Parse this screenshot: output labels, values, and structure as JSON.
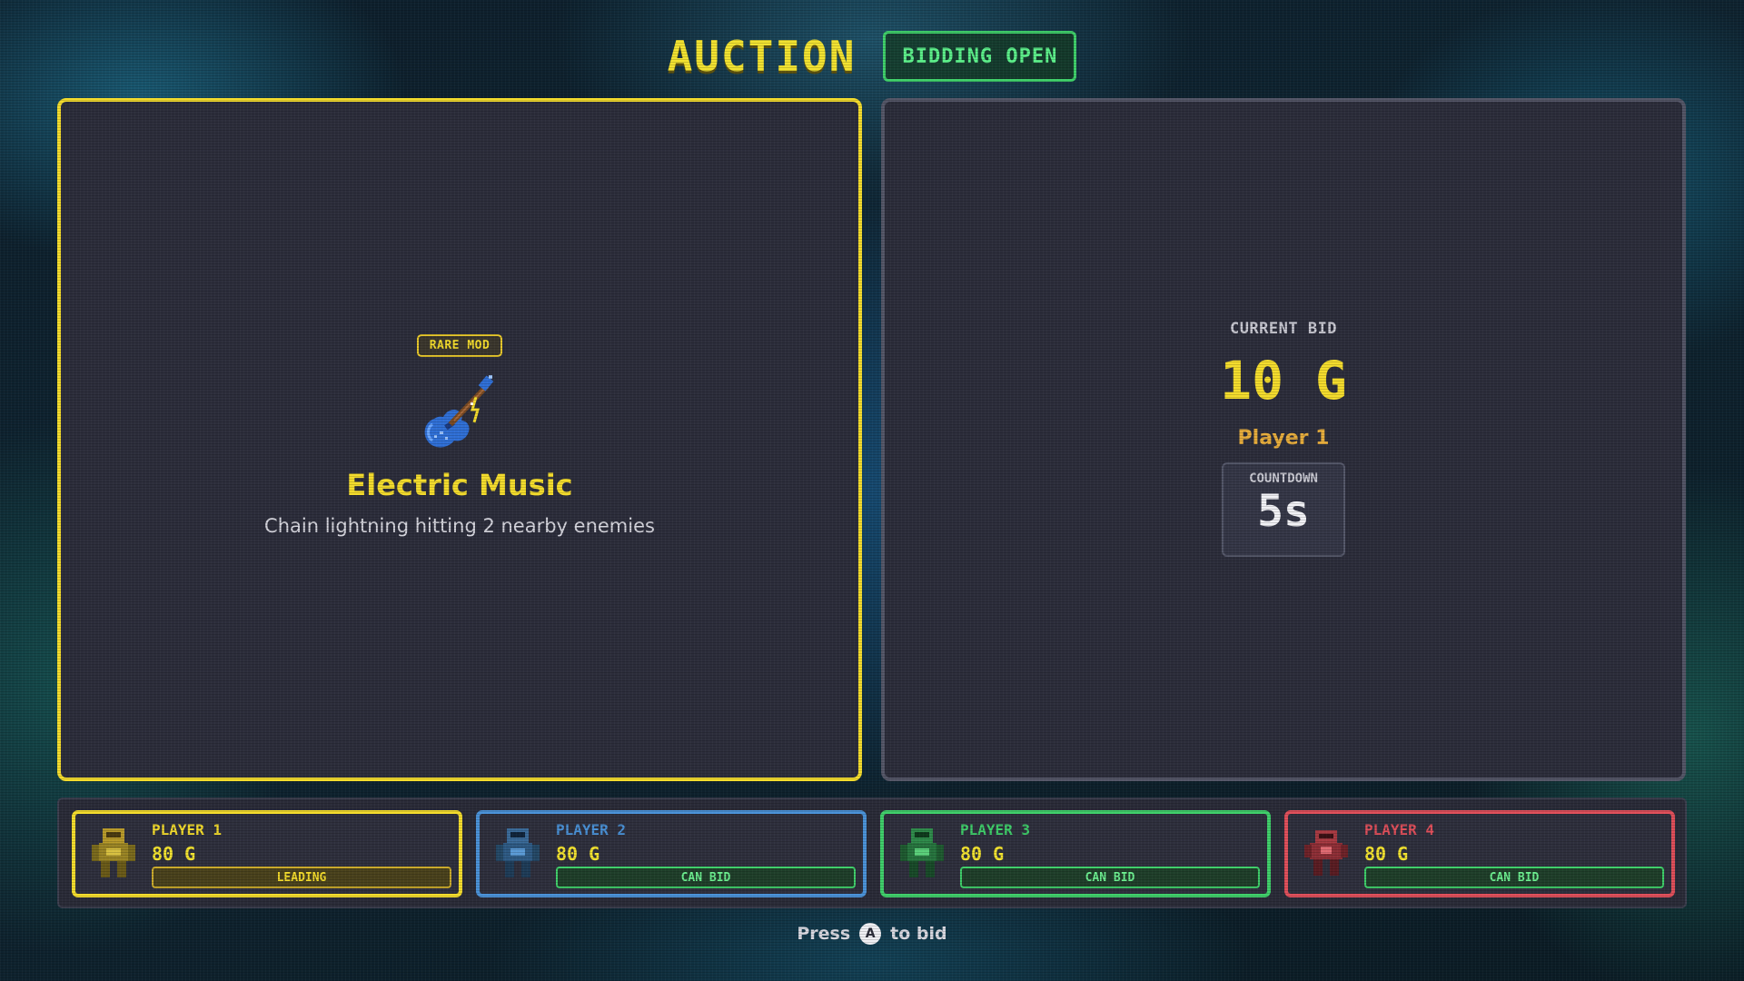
{
  "header": {
    "title": "AUCTION",
    "status": "BIDDING OPEN"
  },
  "item": {
    "rarity": "RARE MOD",
    "icon": "electric-guitar-icon",
    "name": "Electric Music",
    "description": "Chain lightning hitting 2 nearby enemies"
  },
  "bid": {
    "label": "CURRENT BID",
    "amount": "10 G",
    "leader": "Player 1",
    "countdown_label": "COUNTDOWN",
    "countdown_value": "5s"
  },
  "players": [
    {
      "name": "PLAYER 1",
      "gold": "80 G",
      "status": "LEADING",
      "color": "#f4dc2c",
      "avatar": "yellow-mech-avatar"
    },
    {
      "name": "PLAYER 2",
      "gold": "80 G",
      "status": "CAN BID",
      "color": "#4a92d8",
      "avatar": "blue-mech-avatar"
    },
    {
      "name": "PLAYER 3",
      "gold": "80 G",
      "status": "CAN BID",
      "color": "#3fcf6a",
      "avatar": "green-mech-avatar"
    },
    {
      "name": "PLAYER 4",
      "gold": "80 G",
      "status": "CAN BID",
      "color": "#e04f5a",
      "avatar": "red-mech-avatar"
    }
  ],
  "prompt": {
    "before": "Press",
    "button": "A",
    "after": "to bid"
  },
  "colors": {
    "accent_yellow": "#f4dc2c",
    "open_green": "#5cf08a",
    "panel_bg": "#2c2d3b"
  }
}
